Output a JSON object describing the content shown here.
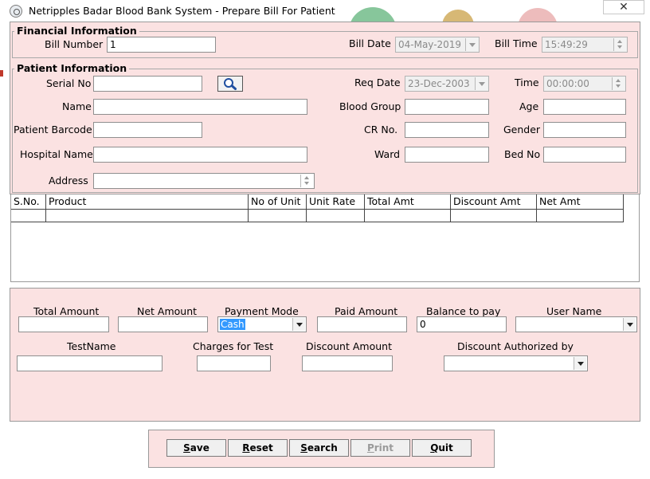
{
  "window": {
    "title": "Netripples Badar Blood Bank System - Prepare Bill For Patient",
    "close_glyph": "✕"
  },
  "financial": {
    "legend": "Financial Information",
    "bill_number_label": "Bill Number",
    "bill_number_value": "1",
    "bill_date_label": "Bill Date",
    "bill_date_value": "04-May-2019",
    "bill_time_label": "Bill Time",
    "bill_time_value": "15:49:29"
  },
  "patient": {
    "legend": "Patient Information",
    "serial_no_label": "Serial No",
    "serial_no_value": "",
    "req_date_label": "Req Date",
    "req_date_value": "23-Dec-2003",
    "time_label": "Time",
    "time_value": "00:00:00",
    "name_label": "Name",
    "name_value": "",
    "blood_group_label": "Blood Group",
    "blood_group_value": "",
    "age_label": "Age",
    "age_value": "",
    "barcode_label": "Patient Barcode",
    "barcode_value": "",
    "cr_no_label": "CR No.",
    "cr_no_value": "",
    "gender_label": "Gender",
    "gender_value": "",
    "hospital_label": "Hospital Name",
    "hospital_value": "",
    "ward_label": "Ward",
    "ward_value": "",
    "bed_no_label": "Bed No",
    "bed_no_value": "",
    "address_label": "Address",
    "address_value": ""
  },
  "grid": {
    "columns": [
      "S.No.",
      "Product",
      "No of Unit",
      "Unit Rate",
      "Total Amt",
      "Discount Amt",
      "Net Amt"
    ]
  },
  "billing": {
    "total_amount_label": "Total Amount",
    "total_amount_value": "",
    "net_amount_label": "Net Amount",
    "net_amount_value": "",
    "payment_mode_label": "Payment Mode",
    "payment_mode_value": "Cash",
    "paid_amount_label": "Paid Amount",
    "paid_amount_value": "",
    "balance_label": "Balance to pay",
    "balance_value": "0",
    "user_name_label": "User Name",
    "user_name_value": "",
    "test_name_label": "TestName",
    "test_name_value": "",
    "charges_label": "Charges for Test",
    "charges_value": "",
    "discount_amount_label": "Discount Amount",
    "discount_amount_value": "",
    "discount_auth_label": "Discount Authorized by",
    "discount_auth_value": ""
  },
  "buttons": {
    "save": {
      "key": "S",
      "rest": "ave"
    },
    "reset": {
      "key": "R",
      "rest": "eset"
    },
    "search": {
      "key": "S",
      "rest": "earch"
    },
    "print": {
      "key": "P",
      "rest": "rint"
    },
    "quit": {
      "key": "Q",
      "rest": "uit"
    }
  },
  "colors": {
    "form_background": "#fbe2e2",
    "selection": "#3399ff"
  }
}
